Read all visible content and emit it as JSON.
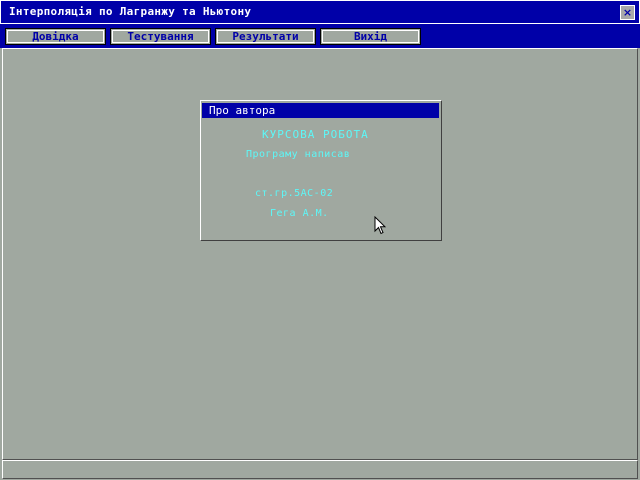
{
  "window": {
    "title": "Інтерполяція по Лагранжу та Ньютону",
    "close_icon": "close-icon",
    "close_label": "×"
  },
  "menu": {
    "items": [
      {
        "label": "Довідка"
      },
      {
        "label": "Тестування"
      },
      {
        "label": "Результати"
      },
      {
        "label": "Вихід"
      }
    ]
  },
  "dialog": {
    "title": "Про автора",
    "lines": [
      "КУРСОВА  РОБОТА",
      "Програму написав",
      "ст.гр.5АС-02",
      "Гега А.М."
    ]
  },
  "colors": {
    "desktop": "#a0a8a0",
    "title_bar": "#0000a8",
    "dialog_text": "#5cf8f8"
  },
  "icons": {
    "cursor": "mouse-pointer-icon"
  }
}
